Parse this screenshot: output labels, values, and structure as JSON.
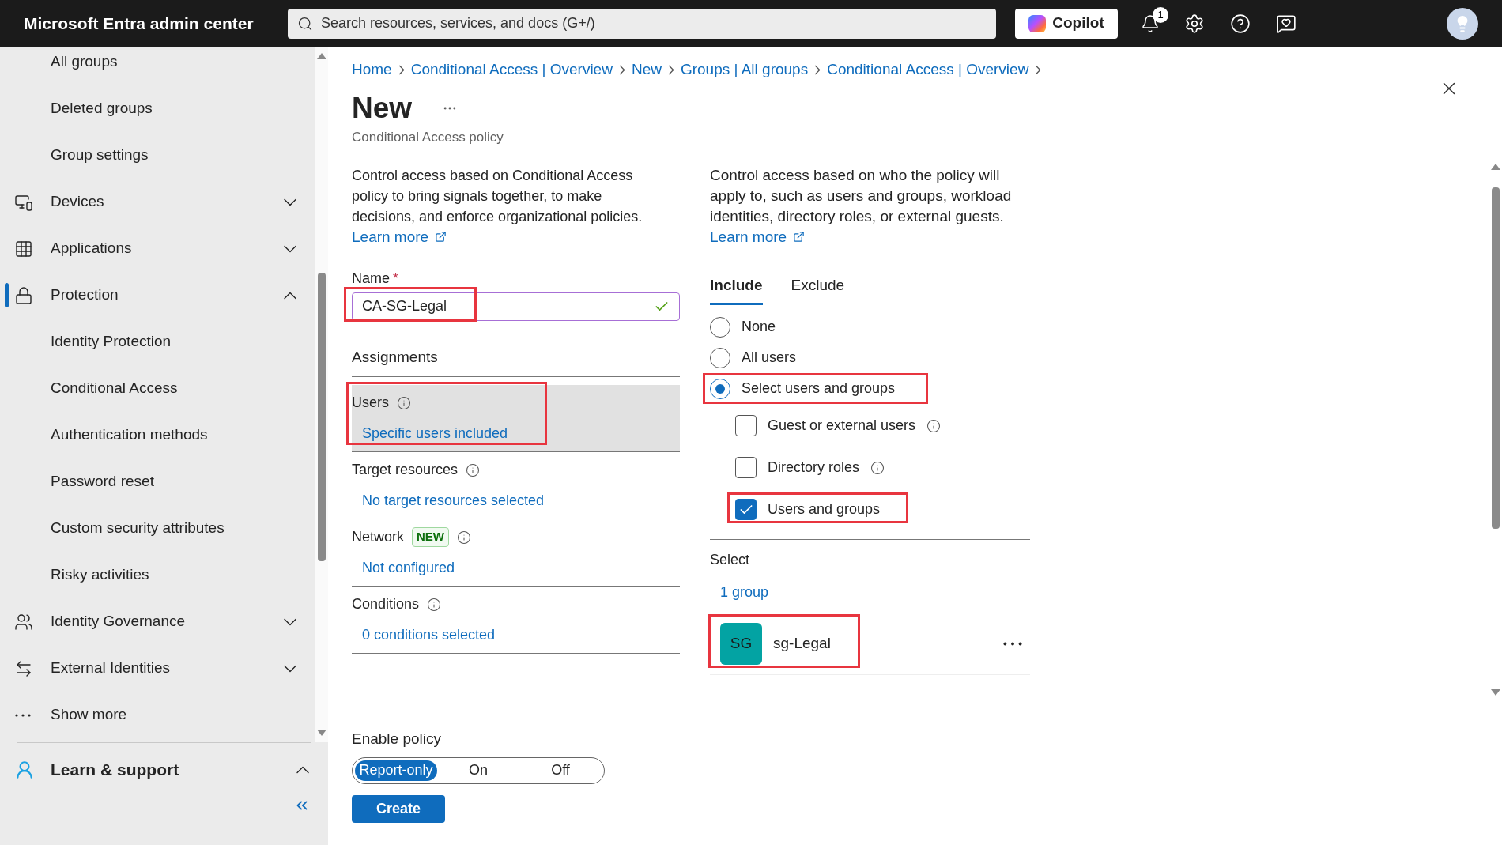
{
  "topbar": {
    "title": "Microsoft Entra admin center",
    "search": {
      "placeholder": "Search resources, services, and docs (G+/)"
    },
    "copilot": "Copilot",
    "notifications": "1"
  },
  "sidebar": {
    "items": [
      {
        "kind": "subitem",
        "label": "All groups"
      },
      {
        "kind": "subitem",
        "label": "Deleted groups"
      },
      {
        "kind": "subitem",
        "label": "Group settings"
      },
      {
        "kind": "group",
        "label": "Devices",
        "expanded": false,
        "selected": false
      },
      {
        "kind": "group",
        "label": "Applications",
        "expanded": false,
        "selected": false
      },
      {
        "kind": "group",
        "label": "Protection",
        "expanded": true,
        "selected": true,
        "children": [
          {
            "label": "Identity Protection"
          },
          {
            "label": "Conditional Access"
          },
          {
            "label": "Authentication methods"
          },
          {
            "label": "Password reset"
          },
          {
            "label": "Custom security attributes"
          },
          {
            "label": "Risky activities"
          }
        ]
      },
      {
        "kind": "group",
        "label": "Identity Governance",
        "expanded": false,
        "selected": false
      },
      {
        "kind": "group",
        "label": "External Identities",
        "expanded": false,
        "selected": false
      },
      {
        "kind": "more",
        "label": "Show more"
      }
    ],
    "footer": {
      "label": "Learn & support",
      "expanded": true
    }
  },
  "breadcrumb": [
    "Home",
    "Conditional Access | Overview",
    "New",
    "Groups | All groups",
    "Conditional Access | Overview"
  ],
  "page": {
    "title": "New",
    "subtitle": "Conditional Access policy"
  },
  "left": {
    "description": "Control access based on Conditional Access policy to bring signals together, to make decisions, and enforce organizational policies.",
    "learn_more": "Learn more",
    "name": {
      "label": "Name",
      "required_mark": "*",
      "value": "CA-SG-Legal",
      "valid": true,
      "highlighted": true
    },
    "assignments_title": "Assignments",
    "assignments": [
      {
        "label": "Users",
        "value": "Specific users included",
        "selected": true,
        "highlighted": true
      },
      {
        "label": "Target resources",
        "value": "No target resources selected",
        "selected": false,
        "highlighted": false
      },
      {
        "label": "Network",
        "badge": "NEW",
        "value": "Not configured",
        "selected": false,
        "highlighted": false
      },
      {
        "label": "Conditions",
        "value": "0 conditions selected",
        "selected": false,
        "highlighted": false
      }
    ]
  },
  "right": {
    "description": "Control access based on who the policy will apply to, such as users and groups, workload identities, directory roles, or external guests.",
    "learn_more": "Learn more",
    "tabs": [
      {
        "label": "Include",
        "selected": true
      },
      {
        "label": "Exclude",
        "selected": false
      }
    ],
    "radios": [
      {
        "label": "None",
        "selected": false,
        "highlighted": false
      },
      {
        "label": "All users",
        "selected": false,
        "highlighted": false
      },
      {
        "label": "Select users and groups",
        "selected": true,
        "highlighted": true
      }
    ],
    "checkboxes": [
      {
        "label": "Guest or external users",
        "checked": false,
        "info": true,
        "highlighted": false
      },
      {
        "label": "Directory roles",
        "checked": false,
        "info": true,
        "highlighted": false
      },
      {
        "label": "Users and groups",
        "checked": true,
        "info": false,
        "highlighted": true
      }
    ],
    "select_label": "Select",
    "select_value": "1 group",
    "selected_items": [
      {
        "initials": "SG",
        "name": "sg-Legal",
        "color": "#03a3a3",
        "highlighted": true
      }
    ]
  },
  "enable_policy": {
    "label": "Enable policy",
    "options": [
      {
        "label": "Report-only",
        "selected": true
      },
      {
        "label": "On",
        "selected": false
      },
      {
        "label": "Off",
        "selected": false
      }
    ]
  },
  "create": "Create"
}
